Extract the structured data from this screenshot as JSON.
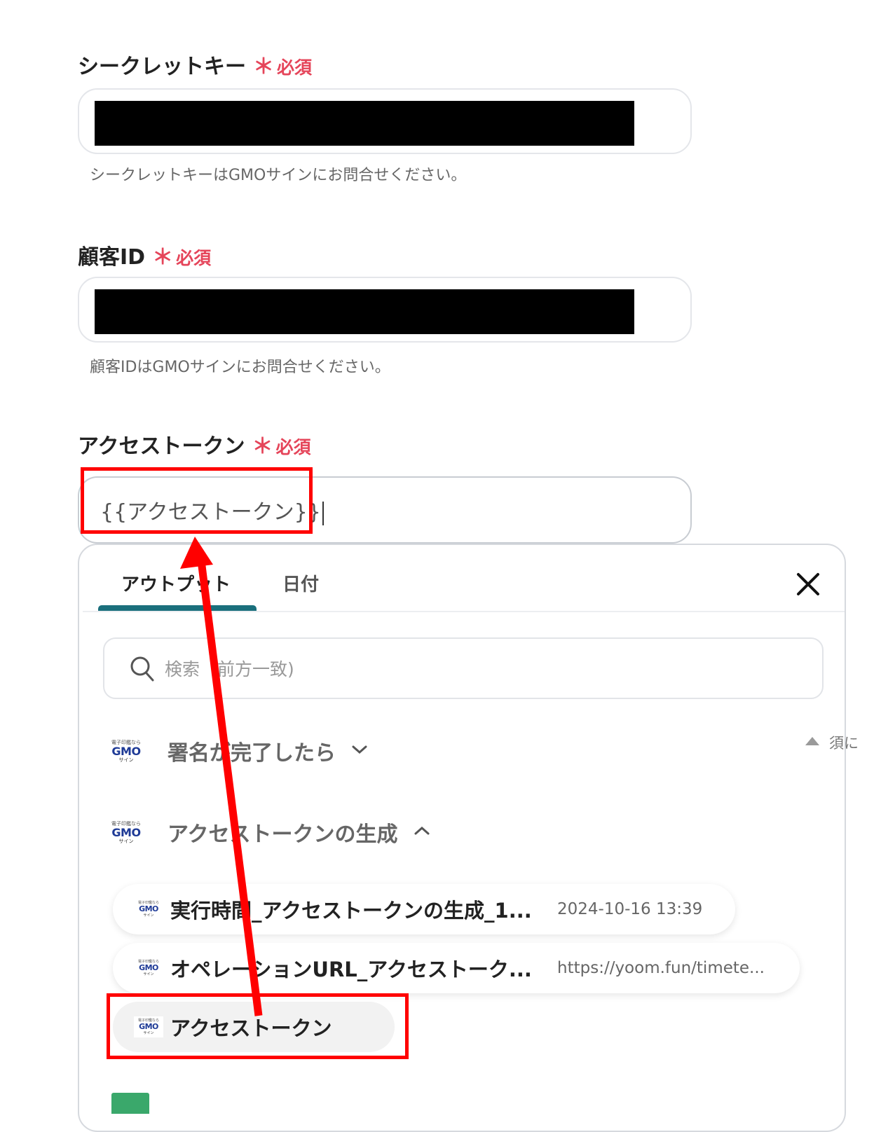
{
  "secret_key": {
    "label": "シークレットキー",
    "required": "必須",
    "required_mark": "＊",
    "hint": "シークレットキーはGMOサインにお問合せください。"
  },
  "customer_id": {
    "label": "顧客ID",
    "required": "必須",
    "required_mark": "＊",
    "hint": "顧客IDはGMOサインにお問合せください。"
  },
  "access_token": {
    "label": "アクセストークン",
    "required": "必須",
    "required_mark": "＊",
    "value": "{{アクセストークン}}"
  },
  "panel": {
    "tabs": [
      "アウトプット",
      "日付"
    ],
    "active_tab": "アウトプット",
    "search_placeholder": "検索（前方一致)",
    "groups": [
      {
        "title": "署名が完了したら",
        "expanded": false
      },
      {
        "title": "アクセストークンの生成",
        "expanded": true
      }
    ],
    "items": [
      {
        "title": "実行時間_アクセストークンの生成_1...",
        "value": "2024-10-16 13:39"
      },
      {
        "title": "オペレーションURL_アクセストーク...",
        "value": "https://yoom.fun/timete..."
      },
      {
        "title": "アクセストークン",
        "value": ""
      }
    ]
  },
  "gmo_logo": {
    "top": "電子印鑑なら",
    "mid": "GMO",
    "bottom": "サイン"
  },
  "side_text": "須に",
  "colors": {
    "required": "#e5455a",
    "tab_underline": "#1a6f7c",
    "annotation": "#ff0000",
    "gmo_blue": "#1e3a96"
  }
}
